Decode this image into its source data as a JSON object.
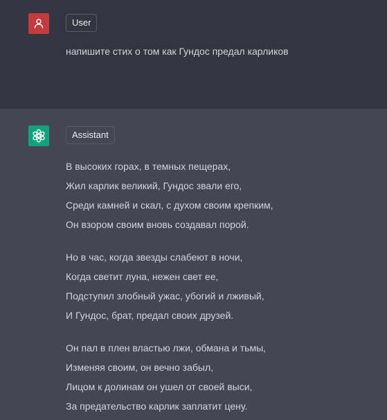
{
  "conversation": {
    "user": {
      "role_label": "User",
      "icon": "user-icon",
      "avatar_color": "#c33c3c",
      "text": "напишите стих о том как Гундос предал карликов"
    },
    "assistant": {
      "role_label": "Assistant",
      "icon": "openai-logo-icon",
      "avatar_color": "#10a37f",
      "stanzas": [
        [
          "В высоких горах, в темных пещерах,",
          "Жил карлик великий, Гундос звали его,",
          "Среди камней и скал, с духом своим крепким,",
          "Он взором своим вновь создавал порой."
        ],
        [
          "Но в час, когда звезды слабеют в ночи,",
          "Когда светит луна, нежен свет ее,",
          "Подступил злобный ужас, убогий и лживый,",
          "И Гундос, брат, предал своих друзей."
        ],
        [
          "Он пал в плен властью лжи, обмана и тьмы,",
          "Изменяя своим, он вечно забыл,",
          "Лицом к долинам он ушел от своей выси,",
          "За предательство карлик заплатит цену."
        ]
      ]
    }
  },
  "colors": {
    "user_row_bg": "#343541",
    "assistant_row_bg": "#444654",
    "text": "#d1d5db"
  }
}
